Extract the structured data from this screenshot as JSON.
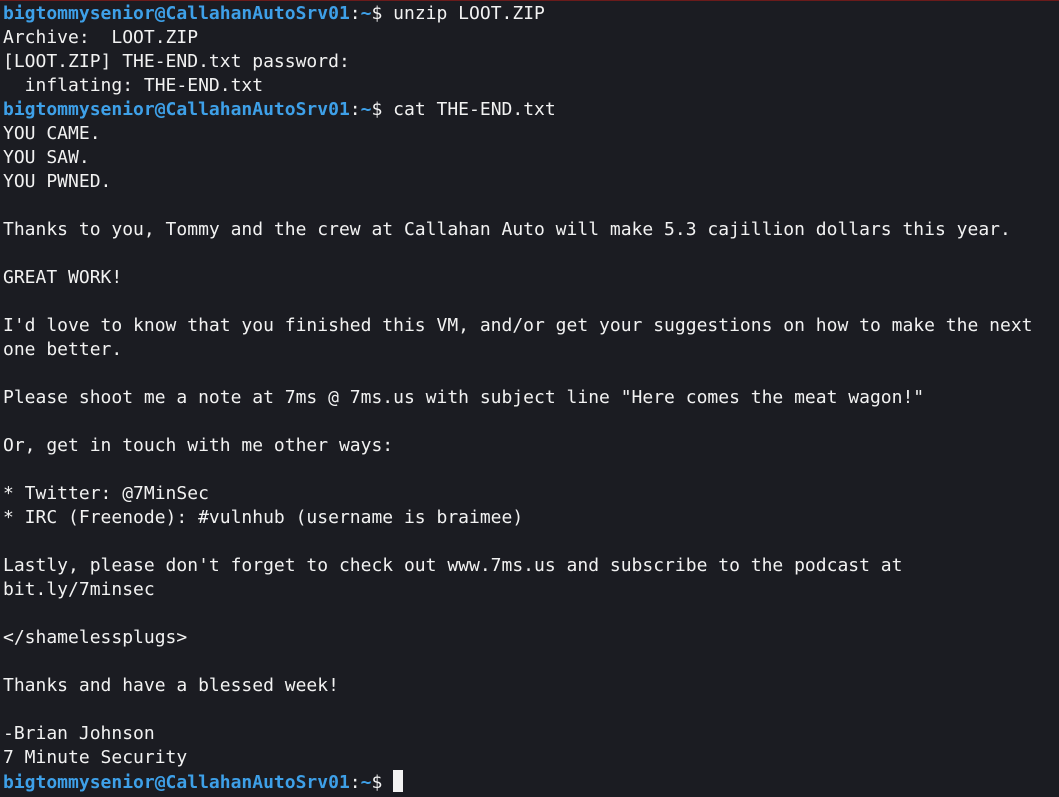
{
  "prompt": {
    "user_host": "bigtommysenior@CallahanAutoSrv01",
    "colon": ":",
    "path": "~",
    "symbol": "$ "
  },
  "commands": [
    "unzip LOOT.ZIP",
    "cat THE-END.txt"
  ],
  "output": {
    "unzip": [
      "Archive:  LOOT.ZIP",
      "[LOOT.ZIP] THE-END.txt password:",
      "  inflating: THE-END.txt"
    ],
    "file": [
      "YOU CAME.",
      "YOU SAW.",
      "YOU PWNED.",
      "",
      "Thanks to you, Tommy and the crew at Callahan Auto will make 5.3 cajillion dollars this year.",
      "",
      "GREAT WORK!",
      "",
      "I'd love to know that you finished this VM, and/or get your suggestions on how to make the next",
      "one better.",
      "",
      "Please shoot me a note at 7ms @ 7ms.us with subject line \"Here comes the meat wagon!\"",
      "",
      "Or, get in touch with me other ways:",
      "",
      "* Twitter: @7MinSec",
      "* IRC (Freenode): #vulnhub (username is braimee)",
      "",
      "Lastly, please don't forget to check out www.7ms.us and subscribe to the podcast at",
      "bit.ly/7minsec",
      "",
      "</shamelessplugs>",
      "",
      "Thanks and have a blessed week!",
      "",
      "-Brian Johnson",
      "7 Minute Security"
    ]
  }
}
